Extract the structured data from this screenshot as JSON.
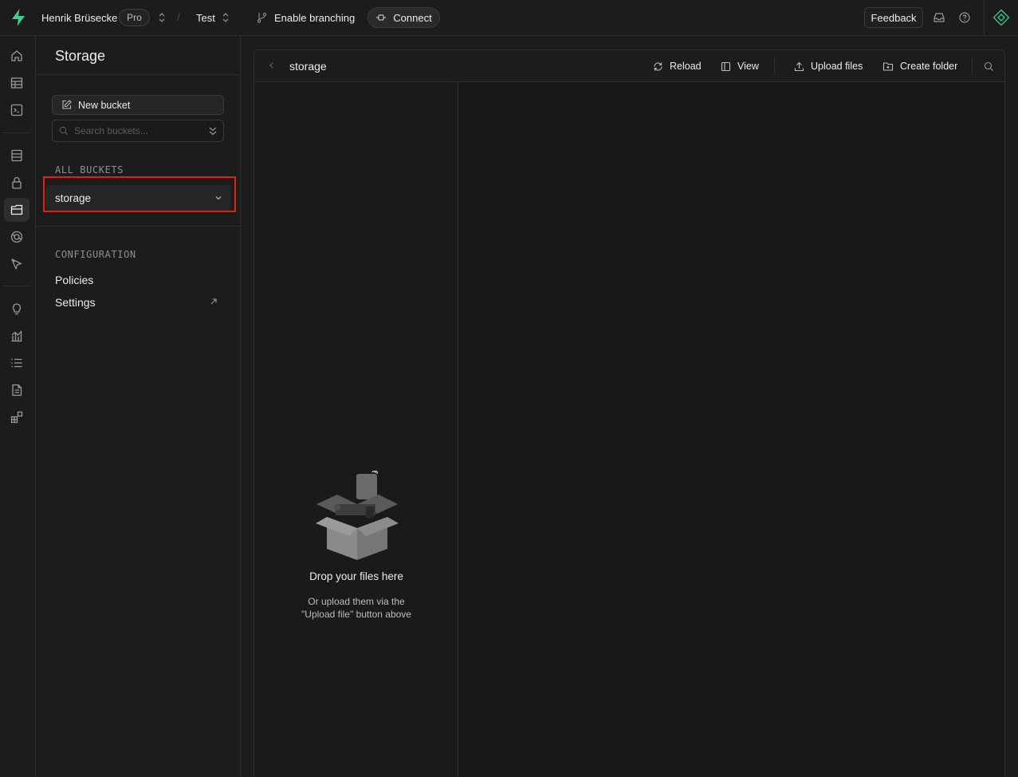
{
  "topbar": {
    "org_name": "Henrik Brüsecke",
    "plan_badge": "Pro",
    "separator": "/",
    "project_name": "Test",
    "branching_label": "Enable branching",
    "connect_label": "Connect",
    "feedback_label": "Feedback",
    "icons": [
      "supabase-logo-icon",
      "inbox-icon",
      "help-icon",
      "assistant-icon"
    ],
    "brand_color": "#3ecf8e"
  },
  "rail": {
    "items": [
      {
        "icon": "home-icon"
      },
      {
        "icon": "table-editor-icon"
      },
      {
        "icon": "sql-editor-icon"
      },
      {
        "icon": "database-icon"
      },
      {
        "icon": "authentication-icon"
      },
      {
        "icon": "storage-icon",
        "active": true
      },
      {
        "icon": "edge-functions-icon"
      },
      {
        "icon": "realtime-icon"
      },
      {
        "icon": "advisors-icon"
      },
      {
        "icon": "reports-icon"
      },
      {
        "icon": "logs-icon"
      },
      {
        "icon": "api-docs-icon"
      },
      {
        "icon": "integrations-icon"
      }
    ]
  },
  "sidebar": {
    "title": "Storage",
    "new_bucket_label": "New bucket",
    "search_placeholder": "Search buckets...",
    "all_buckets_label": "ALL BUCKETS",
    "buckets": [
      {
        "name": "storage",
        "selected": true
      }
    ],
    "configuration_label": "CONFIGURATION",
    "config_links": [
      {
        "label": "Policies",
        "external": false
      },
      {
        "label": "Settings",
        "external": true
      }
    ],
    "highlight_color": "#e0201c"
  },
  "explorer": {
    "title": "storage",
    "reload_label": "Reload",
    "view_label": "View",
    "upload_label": "Upload files",
    "create_folder_label": "Create folder",
    "drop_title": "Drop your files here",
    "drop_subtitle_line1": "Or upload them via the",
    "drop_subtitle_line2": "\"Upload file\" button above"
  }
}
